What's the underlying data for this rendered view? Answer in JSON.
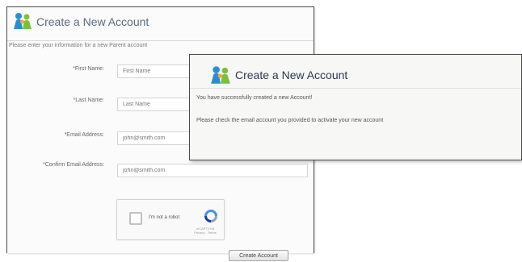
{
  "registration_form": {
    "title": "Create a New Account",
    "instructions": "Please enter your information for a new Parent account",
    "fields": [
      {
        "label": "*First Name:",
        "placeholder": "First Name"
      },
      {
        "label": "*Last Name:",
        "placeholder": "Last Name"
      },
      {
        "label": "*Email Address:",
        "placeholder": "john@smith.com"
      },
      {
        "label": "*Confirm Email Address:",
        "placeholder": "john@smith.com"
      }
    ],
    "captcha": {
      "label": "I'm not a robot",
      "brand": "reCAPTCHA",
      "links": "Privacy - Terms"
    },
    "submit_label": "Create Account"
  },
  "confirmation_dialog": {
    "title": "Create a New Account",
    "message_line1": "You have successfully created a new Account!",
    "message_line2": "Please check the email account you provided to activate your new account"
  },
  "colors": {
    "logo_blue": "#2a8fd0",
    "logo_green": "#7bbf3a",
    "title_text": "#5a6b7f",
    "recaptcha_blue": "#4a90e2"
  }
}
